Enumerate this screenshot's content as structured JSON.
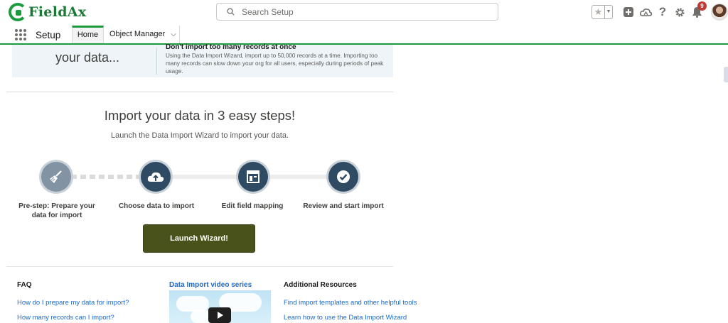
{
  "header": {
    "logo_text": "FieldAx",
    "search_placeholder": "Search Setup",
    "notification_count": "9"
  },
  "nav": {
    "app_name": "Setup",
    "tabs": [
      {
        "label": "Home",
        "active": true
      },
      {
        "label": "Object Manager",
        "active": false
      }
    ]
  },
  "banner": {
    "left_text": "your data...",
    "heading": "Don't import too many records at once",
    "body": "Using the Data Import Wizard, import up to 50,000 records at a time. Importing too many records can slow down your org for all users, especially during periods of peak usage."
  },
  "steps": {
    "title": "Import your data in 3 easy steps!",
    "subtitle": "Launch the Data Import Wizard to import your data.",
    "items": [
      {
        "label": "Pre-step: Prepare your data for import",
        "icon": "broom-icon"
      },
      {
        "label": "Choose data to import",
        "icon": "cloud-upload-icon"
      },
      {
        "label": "Edit field mapping",
        "icon": "layout-icon"
      },
      {
        "label": "Review and start import",
        "icon": "check-icon"
      }
    ],
    "button_label": "Launch Wizard!"
  },
  "resources": {
    "faq_heading": "FAQ",
    "faq_links": [
      "How do I prepare my data for import?",
      "How many records can I import?"
    ],
    "video_heading": "Data Import video series",
    "additional_heading": "Additional Resources",
    "additional_links": [
      "Find import templates and other helpful tools",
      "Learn how to use the Data Import Wizard"
    ]
  },
  "colors": {
    "brand_green": "#1a9c3e",
    "step_navy": "#2f4b64",
    "button_olive": "#4a521b",
    "link_blue": "#1b6ac9"
  }
}
